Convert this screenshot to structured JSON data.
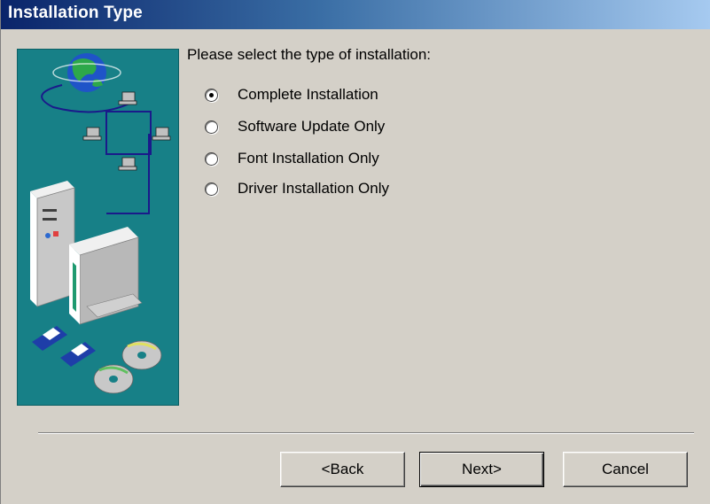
{
  "window": {
    "title": "Installation Type"
  },
  "content": {
    "prompt": "Please select the type of installation:",
    "options": [
      {
        "label": "Complete Installation",
        "selected": true
      },
      {
        "label": "Software Update Only",
        "selected": false
      },
      {
        "label": "Font Installation Only",
        "selected": false
      },
      {
        "label": "Driver Installation Only",
        "selected": false
      }
    ]
  },
  "buttons": {
    "back_label": "<Back",
    "next_label": "Next>",
    "cancel_label": "Cancel"
  },
  "illustration": {
    "icons": [
      "globe-icon",
      "network-computer-icon",
      "tower-computer-icon",
      "monitor-icon",
      "floppy-disk-icon",
      "cd-icon"
    ],
    "background_color": "#178087"
  }
}
